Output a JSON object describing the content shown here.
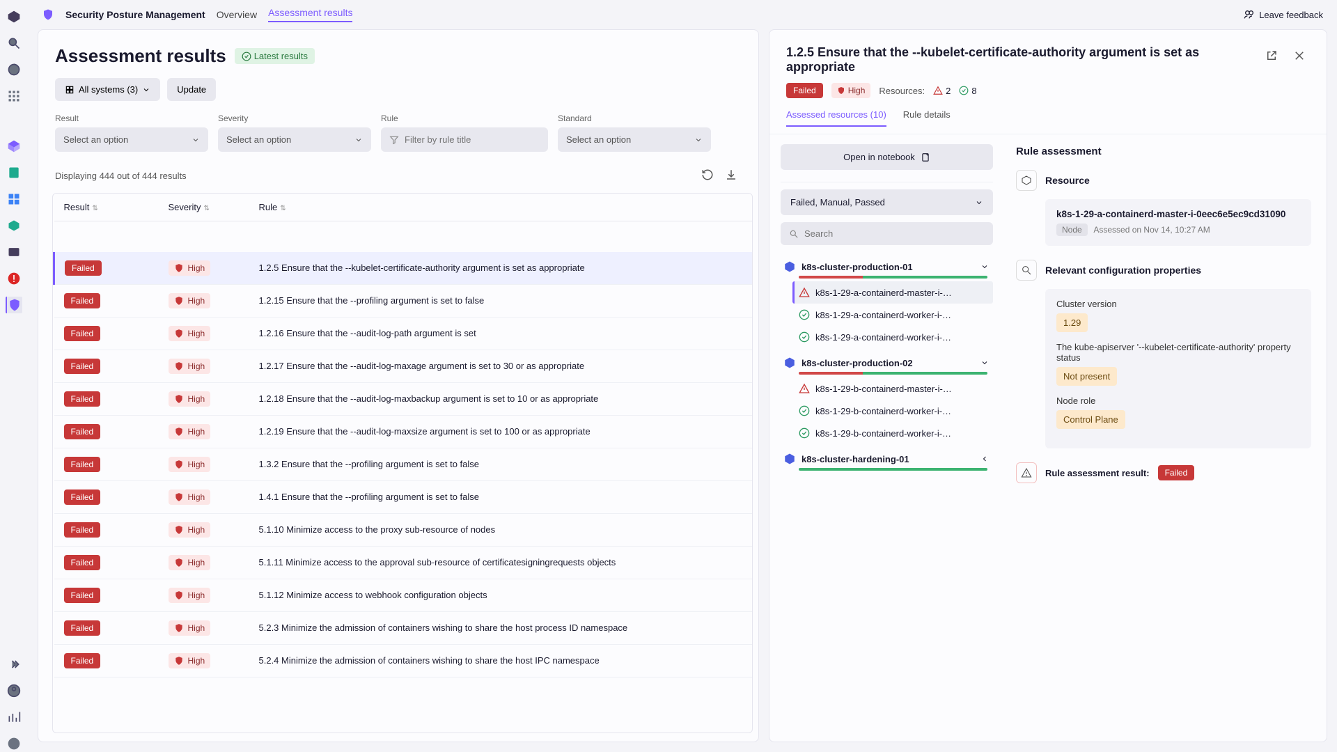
{
  "topbar": {
    "app_title": "Security Posture Management",
    "tabs": [
      "Overview",
      "Assessment results"
    ],
    "active_tab": 1,
    "feedback": "Leave feedback"
  },
  "left_panel": {
    "title": "Assessment results",
    "latest_badge": "Latest results",
    "systems_button": "All systems (3)",
    "update_button": "Update",
    "filters": {
      "result": {
        "label": "Result",
        "placeholder": "Select an option"
      },
      "severity": {
        "label": "Severity",
        "placeholder": "Select an option"
      },
      "rule": {
        "label": "Rule",
        "placeholder": "Filter by rule title"
      },
      "standard": {
        "label": "Standard",
        "placeholder": "Select an option"
      }
    },
    "displaying": "Displaying 444 out of 444 results",
    "cols": {
      "result": "Result",
      "severity": "Severity",
      "rule": "Rule"
    },
    "rows": [
      {
        "result": "Failed",
        "severity": "High",
        "rule": "1.2.5 Ensure that the --kubelet-certificate-authority argument is set as appropriate",
        "selected": true
      },
      {
        "result": "Failed",
        "severity": "High",
        "rule": "1.2.15 Ensure that the --profiling argument is set to false"
      },
      {
        "result": "Failed",
        "severity": "High",
        "rule": "1.2.16 Ensure that the --audit-log-path argument is set"
      },
      {
        "result": "Failed",
        "severity": "High",
        "rule": "1.2.17 Ensure that the --audit-log-maxage argument is set to 30 or as appropriate"
      },
      {
        "result": "Failed",
        "severity": "High",
        "rule": "1.2.18 Ensure that the --audit-log-maxbackup argument is set to 10 or as appropriate"
      },
      {
        "result": "Failed",
        "severity": "High",
        "rule": "1.2.19 Ensure that the --audit-log-maxsize argument is set to 100 or as appropriate"
      },
      {
        "result": "Failed",
        "severity": "High",
        "rule": "1.3.2 Ensure that the --profiling argument is set to false"
      },
      {
        "result": "Failed",
        "severity": "High",
        "rule": "1.4.1 Ensure that the --profiling argument is set to false"
      },
      {
        "result": "Failed",
        "severity": "High",
        "rule": "5.1.10 Minimize access to the proxy sub-resource of nodes"
      },
      {
        "result": "Failed",
        "severity": "High",
        "rule": "5.1.11 Minimize access to the approval sub-resource of certificatesigningrequests objects"
      },
      {
        "result": "Failed",
        "severity": "High",
        "rule": "5.1.12 Minimize access to webhook configuration objects"
      },
      {
        "result": "Failed",
        "severity": "High",
        "rule": "5.2.3 Minimize the admission of containers wishing to share the host process ID namespace"
      },
      {
        "result": "Failed",
        "severity": "High",
        "rule": "5.2.4 Minimize the admission of containers wishing to share the host IPC namespace"
      }
    ]
  },
  "right_panel": {
    "title": "1.2.5 Ensure that the --kubelet-certificate-authority argument is set as appropriate",
    "status": "Failed",
    "severity": "High",
    "resources_label": "Resources:",
    "fail_count": "2",
    "pass_count": "8",
    "tabs": {
      "assessed": "Assessed resources (10)",
      "details": "Rule details"
    },
    "notebook_btn": "Open in notebook",
    "status_filter": "Failed, Manual, Passed",
    "search_placeholder": "Search",
    "clusters": [
      {
        "name": "k8s-cluster-production-01",
        "expanded": true,
        "red_pct": 34,
        "nodes": [
          {
            "name": "k8s-1-29-a-containerd-master-i-…",
            "status": "fail",
            "selected": true
          },
          {
            "name": "k8s-1-29-a-containerd-worker-i-…",
            "status": "pass"
          },
          {
            "name": "k8s-1-29-a-containerd-worker-i-…",
            "status": "pass"
          }
        ]
      },
      {
        "name": "k8s-cluster-production-02",
        "expanded": true,
        "red_pct": 34,
        "nodes": [
          {
            "name": "k8s-1-29-b-containerd-master-i-…",
            "status": "fail"
          },
          {
            "name": "k8s-1-29-b-containerd-worker-i-…",
            "status": "pass"
          },
          {
            "name": "k8s-1-29-b-containerd-worker-i-…",
            "status": "pass"
          }
        ]
      },
      {
        "name": "k8s-cluster-hardening-01",
        "expanded": false,
        "red_pct": 0
      }
    ],
    "assessment": {
      "heading": "Rule assessment",
      "resource_label": "Resource",
      "resource_name": "k8s-1-29-a-containerd-master-i-0eec6e5ec9cd31090",
      "node_chip": "Node",
      "assessed_on": "Assessed on Nov 14, 10:27 AM",
      "props_label": "Relevant configuration properties",
      "props": [
        {
          "label": "Cluster version",
          "value": "1.29"
        },
        {
          "label": "The kube-apiserver '--kubelet-certificate-authority' property status",
          "value": "Not present"
        },
        {
          "label": "Node role",
          "value": "Control Plane"
        }
      ],
      "result_label": "Rule assessment result:",
      "result_value": "Failed"
    }
  }
}
